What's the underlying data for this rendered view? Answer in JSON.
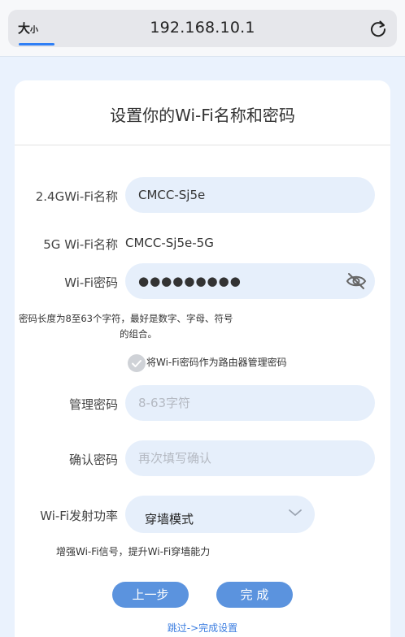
{
  "browser": {
    "text_size_label": "大",
    "text_size_small": "小",
    "url": "192.168.10.1",
    "reload_icon": "reload-icon"
  },
  "page": {
    "title": "设置你的Wi-Fi名称和密码"
  },
  "form": {
    "wifi24_label": "2.4GWi-Fi名称",
    "wifi24_value": "CMCC-Sj5e",
    "wifi5g_label": "5G Wi-Fi名称",
    "wifi5g_value": "CMCC-Sj5e-5G",
    "wifi_password_label": "Wi-Fi密码",
    "wifi_password_value": "●●●●●●●●●",
    "password_hint_line1": "密码长度为8至63个字符，最好是数字、字母、符号",
    "password_hint_line2": "的组合。",
    "use_as_admin_label": "将Wi-Fi密码作为路由器管理密码",
    "admin_password_label": "管理密码",
    "admin_password_placeholder": "8-63字符",
    "confirm_password_label": "确认密码",
    "confirm_password_placeholder": "再次填写确认",
    "tx_power_label": "Wi-Fi发射功率",
    "tx_power_value": "穿墙模式",
    "tx_power_hint": "增强Wi-Fi信号，提升Wi-Fi穿墙能力"
  },
  "actions": {
    "prev_label": "上一步",
    "finish_label": "完 成",
    "skip_label": "跳过->完成设置"
  },
  "colors": {
    "accent": "#5b93de",
    "input_bg": "#e6effb",
    "link": "#3b7de0"
  }
}
